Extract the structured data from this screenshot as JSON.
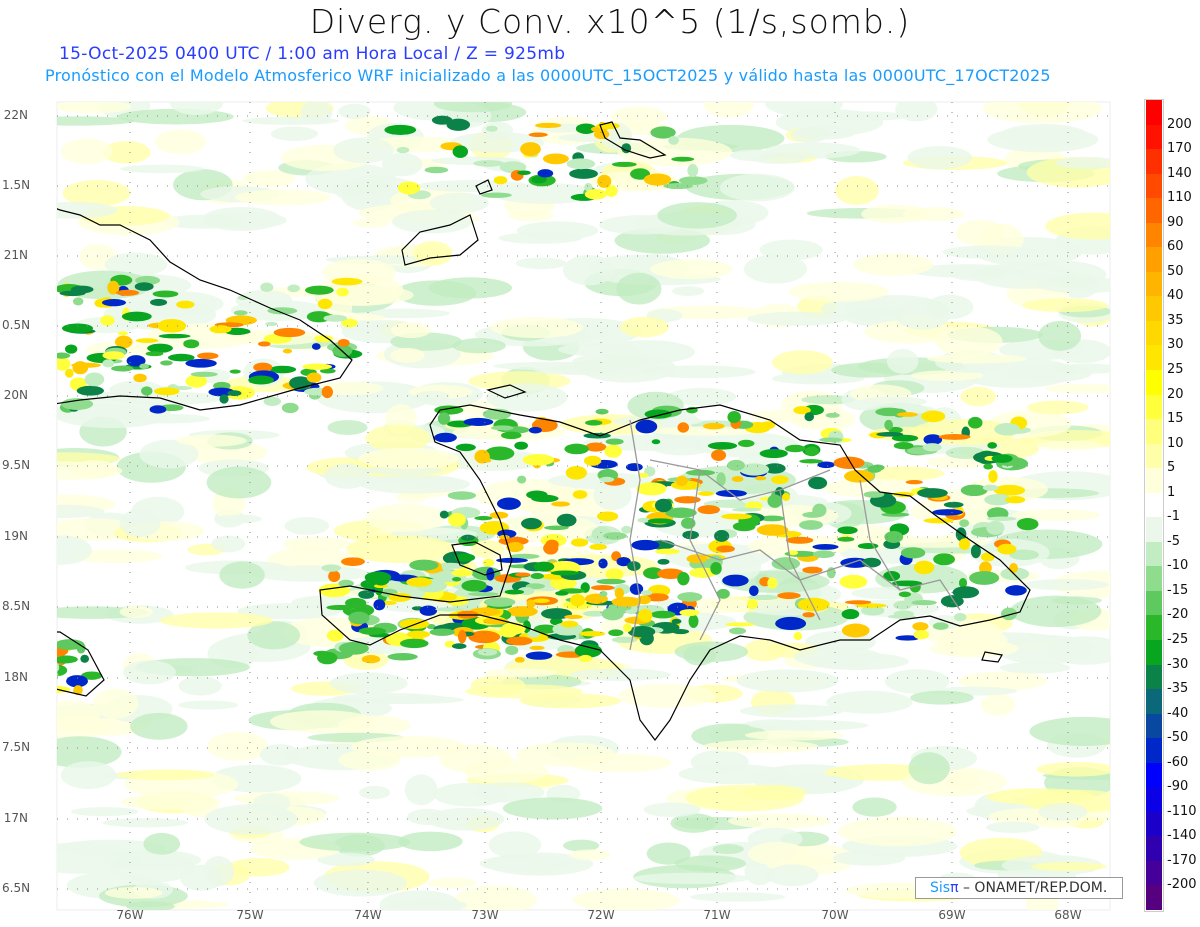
{
  "header": {
    "title": "Diverg. y Conv. x10^5 (1/s,somb.)",
    "subtitle": "15-Oct-2025  0400 UTC / 1:00 am Hora Local / Z = 925mb",
    "description": "Pronóstico con el Modelo Atmosferico WRF inicializado a las 0000UTC_15OCT2025 y válido hasta las  0000UTC_17OCT2025"
  },
  "axes": {
    "lat_labels": [
      "22N",
      "1.5N",
      "21N",
      "0.5N",
      "20N",
      "9.5N",
      "19N",
      "8.5N",
      "18N",
      "7.5N",
      "17N",
      "6.5N"
    ],
    "lon_labels": [
      "76W",
      "75W",
      "74W",
      "73W",
      "72W",
      "71W",
      "70W",
      "69W",
      "68W"
    ]
  },
  "colorbar": {
    "labels": [
      "200",
      "170",
      "140",
      "110",
      "90",
      "60",
      "50",
      "40",
      "35",
      "30",
      "25",
      "20",
      "15",
      "10",
      "5",
      "1",
      "-1",
      "-5",
      "-10",
      "-15",
      "-20",
      "-25",
      "-30",
      "-35",
      "-40",
      "-50",
      "-60",
      "-90",
      "-110",
      "-140",
      "-170",
      "-200"
    ],
    "colors": [
      "#ff0000",
      "#ff1200",
      "#ff3000",
      "#ff4a00",
      "#ff6600",
      "#ff8400",
      "#ffa000",
      "#ffb400",
      "#ffc800",
      "#ffd800",
      "#ffe600",
      "#ffff00",
      "#ffff3c",
      "#ffff7c",
      "#ffffaa",
      "#ffffdc",
      "#ffffff",
      "#eaf7ea",
      "#c2ecc2",
      "#8fdc8f",
      "#5ec95e",
      "#2ab82a",
      "#08a520",
      "#0a8248",
      "#0a6878",
      "#0848a0",
      "#0028c8",
      "#0000ff",
      "#0c00e6",
      "#1a00c8",
      "#3000b0",
      "#440098",
      "#560080"
    ]
  },
  "credit": {
    "brand_prefix": "Sis",
    "brand_symbol": "π",
    "text": "– ONAMET/REP.DOM."
  }
}
